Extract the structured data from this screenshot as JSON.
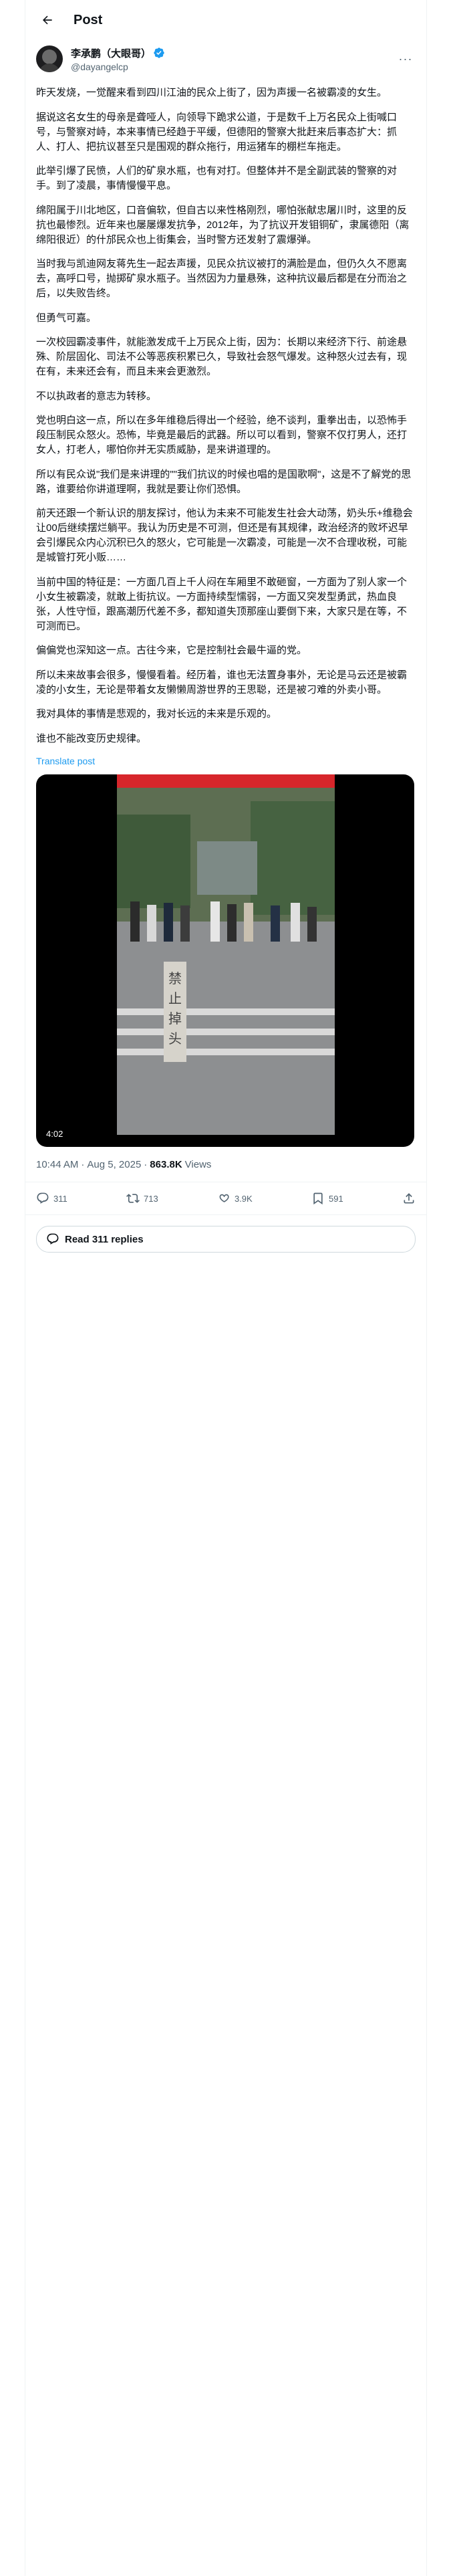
{
  "header": {
    "title": "Post"
  },
  "author": {
    "display_name": "李承鹏（大眼哥）",
    "handle": "@dayangelcp"
  },
  "post": {
    "paragraphs": [
      "昨天发烧，一觉醒来看到四川江油的民众上街了，因为声援一名被霸凌的女生。",
      "据说这名女生的母亲是聋哑人，向领导下跪求公道，于是数千上万名民众上街喊口号，与警察对峙，本来事情已经趋于平缓，但德阳的警察大批赶来后事态扩大：抓人、打人、把抗议甚至只是围观的群众拖行，用运猪车的棚栏车拖走。",
      "此举引爆了民愤，人们的矿泉水瓶，也有对打。但整体并不是全副武装的警察的对手。到了凌晨，事情慢慢平息。",
      "绵阳属于川北地区，口音偏软，但自古以来性格刚烈，哪怕张献忠屠川时，这里的反抗也最惨烈。近年来也屡屡爆发抗争，2012年，为了抗议开发钼铜矿，隶属德阳（离绵阳很近）的什邡民众也上街集会，当时警方还发射了震爆弹。",
      "当时我与凯迪网友蒋先生一起去声援，见民众抗议被打的满脸是血，但仍久久不愿离去，高呼口号，抛掷矿泉水瓶子。当然因为力量悬殊，这种抗议最后都是在分而治之后，以失败告终。",
      "但勇气可嘉。",
      "一次校园霸凌事件，就能激发成千上万民众上街，因为：长期以来经济下行、前途悬殊、阶层固化、司法不公等恶疾积累已久，导致社会怒气爆发。这种怒火过去有，现在有，未来还会有，而且未来会更激烈。",
      "不以执政者的意志为转移。",
      "党也明白这一点，所以在多年维稳后得出一个经验，绝不谈判，重拳出击，以恐怖手段压制民众怒火。恐怖，毕竟是最后的武器。所以可以看到，警察不仅打男人，还打女人，打老人，哪怕你并无实质威胁，是来讲道理的。",
      "所以有民众说\"我们是来讲理的\"\"我们抗议的时候也唱的是国歌啊\"，这是不了解党的思路，谁要给你讲道理啊，我就是要让你们恐惧。",
      "前天还跟一个新认识的朋友探讨，他认为未来不可能发生社会大动荡，奶头乐+维稳会让00后继续摆烂躺平。我认为历史是不可测，但还是有其规律，政治经济的败坏迟早会引爆民众内心沉积已久的怒火，它可能是一次霸凌，可能是一次不合理收税，可能是城管打死小贩……",
      "当前中国的特征是：一方面几百上千人闷在车厢里不敢砸窗，一方面为了别人家一个小女生被霸凌，就敢上街抗议。一方面持续型懦弱，一方面又突发型勇武，热血良张，人性守恒，跟高潮历代差不多，都知道失顶那座山要倒下来，大家只是在等，不可测而已。",
      "偏偏党也深知这一点。古往今来，它是控制社会最牛逼的党。",
      "所以未来故事会很多，慢慢看着。经历着，谁也无法置身事外，无论是马云还是被霸凌的小女生，无论是带着女友懒懒周游世界的王思聪，还是被刁难的外卖小哥。",
      "我对具体的事情是悲观的，我对长远的未来是乐观的。",
      "谁也不能改变历史规律。"
    ],
    "translate_label": "Translate post",
    "video": {
      "duration": "4:02",
      "sign_text": "禁止掉头"
    },
    "time": "10:44 AM",
    "date": "Aug 5, 2025",
    "views_count": "863.8K",
    "views_label": "Views"
  },
  "actions": {
    "replies": "311",
    "reposts": "713",
    "likes": "3.9K",
    "bookmarks": "591"
  },
  "read_replies_label": "Read 311 replies",
  "colors": {
    "link": "#1d9bf0",
    "verified": "#1d9bf0",
    "muted": "#536471",
    "border": "#eff3f4"
  }
}
